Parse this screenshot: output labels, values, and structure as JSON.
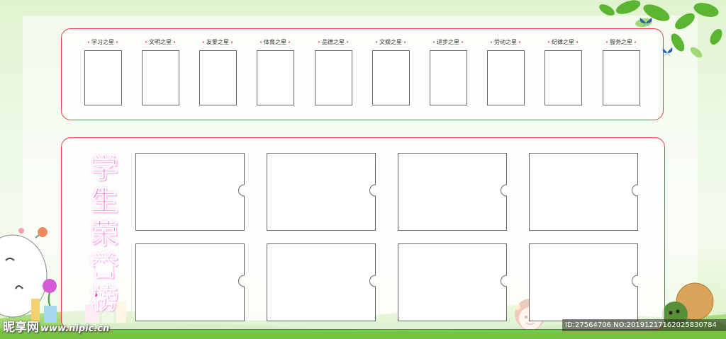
{
  "stars": {
    "labels": [
      "学习之星",
      "文明之星",
      "友爱之星",
      "体育之星",
      "品德之星",
      "文娱之星",
      "进步之星",
      "劳动之星",
      "纪律之星",
      "服务之星"
    ]
  },
  "honor": {
    "title_chars": [
      "学",
      "生",
      "荣",
      "誉",
      "榜"
    ]
  },
  "watermark": {
    "brand": "昵享网",
    "url": "www.nipic.cn"
  },
  "id_bar": {
    "text": "ID:27564706 NO:20191217162025830784"
  },
  "colors": {
    "border_red": "#e04048",
    "title_pink": "#e62fc6",
    "leaf_green": "#5cb531"
  }
}
